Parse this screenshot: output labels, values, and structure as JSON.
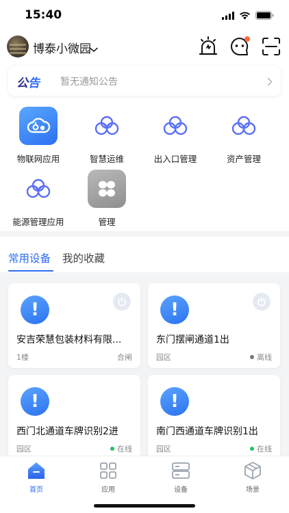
{
  "status_bar": {
    "time": "15:40"
  },
  "header": {
    "campus_name": "博泰小微园"
  },
  "notice": {
    "tag_part1": "公",
    "tag_part2": "告",
    "text": "暂无通知公告"
  },
  "apps": [
    {
      "label": "物联网应用",
      "icon": "iot-cloud-icon"
    },
    {
      "label": "智慧运维",
      "icon": "cloud-icon"
    },
    {
      "label": "出入口管理",
      "icon": "cloud-icon"
    },
    {
      "label": "资产管理",
      "icon": "cloud-icon"
    },
    {
      "label": "能源管理应用",
      "icon": "cloud-icon"
    },
    {
      "label": "管理",
      "icon": "grid-icon"
    }
  ],
  "tabs": {
    "common": "常用设备",
    "favorites": "我的收藏"
  },
  "devices": [
    {
      "name": "安吉荣慧包装材料有限...",
      "zone": "1楼",
      "status": "合闸"
    },
    {
      "name": "东门摆闸通道1出",
      "zone": "园区",
      "status": "离线"
    },
    {
      "name": "西门北通道车牌识别2进",
      "zone": "园区",
      "status": "在线"
    },
    {
      "name": "南门西通道车牌识别1出",
      "zone": "园区",
      "status": "在线"
    }
  ],
  "tabbar": {
    "home": "首页",
    "apps": "应用",
    "devices": "设备",
    "scenes": "场景"
  },
  "colors": {
    "accent": "#2d6cf6",
    "online": "#22c55e",
    "offline": "#777777",
    "notice_dot": "#ff6a3d"
  }
}
